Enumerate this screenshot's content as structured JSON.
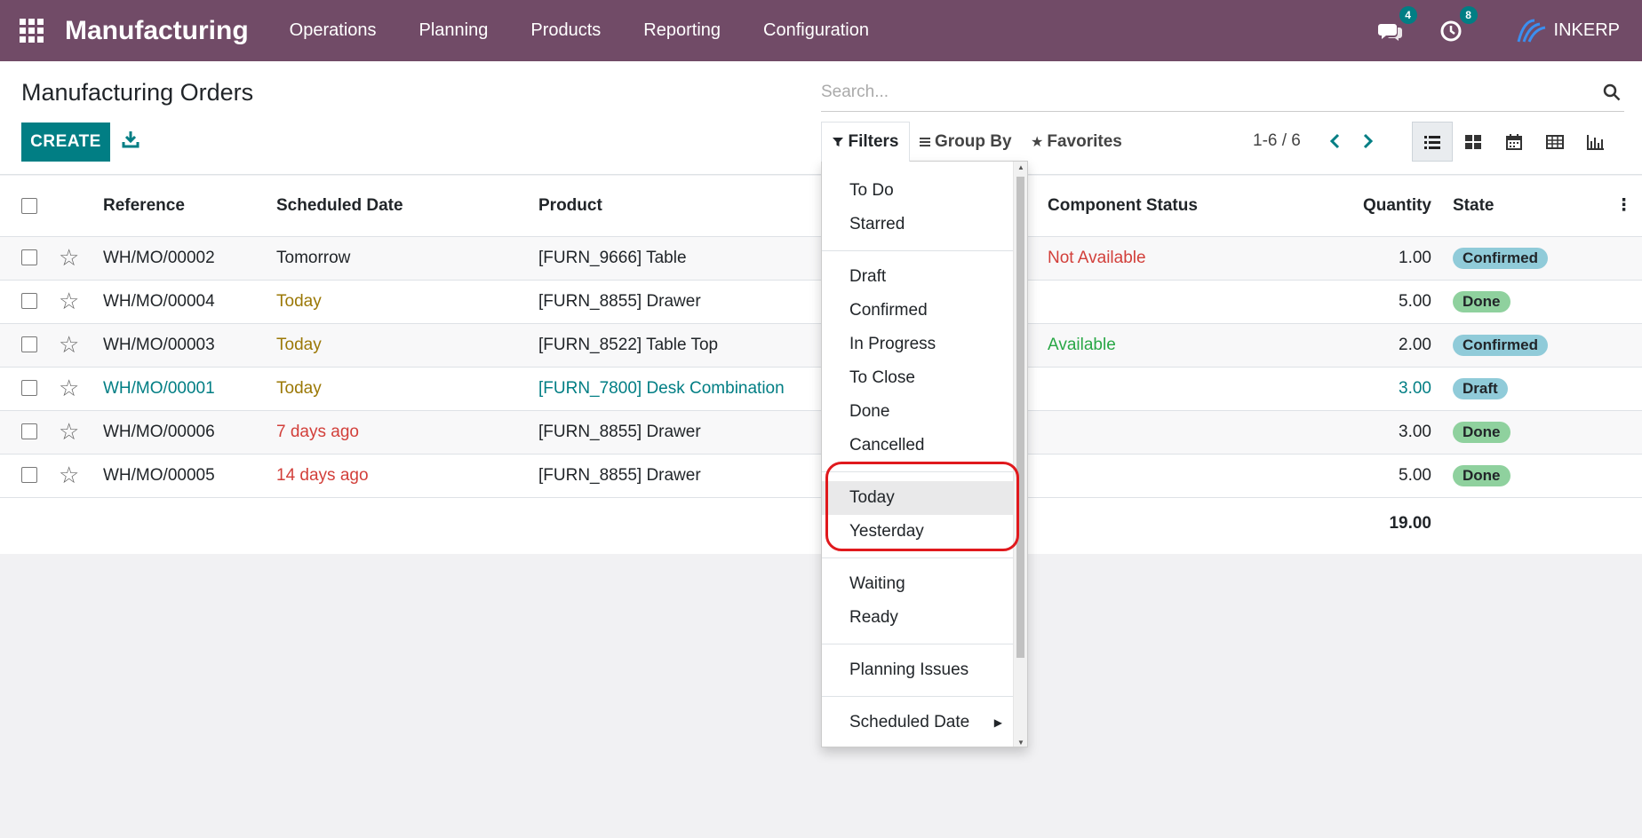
{
  "navbar": {
    "app_name": "Manufacturing",
    "menu": [
      "Operations",
      "Planning",
      "Products",
      "Reporting",
      "Configuration"
    ],
    "messages_count": "4",
    "activities_count": "8",
    "company": "INKERP",
    "bg_color": "#714b67"
  },
  "control": {
    "title": "Manufacturing Orders",
    "create_label": "CREATE",
    "search_placeholder": "Search...",
    "filters_label": "Filters",
    "groupby_label": "Group By",
    "favorites_label": "Favorites",
    "pager": "1-6 / 6"
  },
  "table": {
    "headers": {
      "reference": "Reference",
      "scheduled_date": "Scheduled Date",
      "product": "Product",
      "component_status": "Component Status",
      "quantity": "Quantity",
      "state": "State"
    },
    "rows": [
      {
        "reference": "WH/MO/00002",
        "date": "Tomorrow",
        "product": "[FURN_9666] Table",
        "component_status": "Not Available",
        "quantity": "1.00",
        "state": "Confirmed"
      },
      {
        "reference": "WH/MO/00004",
        "date": "Today",
        "product": "[FURN_8855] Drawer",
        "component_status": "",
        "quantity": "5.00",
        "state": "Done"
      },
      {
        "reference": "WH/MO/00003",
        "date": "Today",
        "product": "[FURN_8522] Table Top",
        "component_status": "Available",
        "quantity": "2.00",
        "state": "Confirmed"
      },
      {
        "reference": "WH/MO/00001",
        "date": "Today",
        "product": "[FURN_7800] Desk Combination",
        "component_status": "",
        "quantity": "3.00",
        "state": "Draft"
      },
      {
        "reference": "WH/MO/00006",
        "date": "7 days ago",
        "product": "[FURN_8855] Drawer",
        "component_status": "",
        "quantity": "3.00",
        "state": "Done"
      },
      {
        "reference": "WH/MO/00005",
        "date": "14 days ago",
        "product": "[FURN_8855] Drawer",
        "component_status": "",
        "quantity": "5.00",
        "state": "Done"
      }
    ],
    "total_quantity": "19.00"
  },
  "filters_dropdown": {
    "group1": [
      "To Do",
      "Starred"
    ],
    "group2": [
      "Draft",
      "Confirmed",
      "In Progress",
      "To Close",
      "Done",
      "Cancelled"
    ],
    "group3": [
      "Today",
      "Yesterday"
    ],
    "group4": [
      "Waiting",
      "Ready"
    ],
    "group5": [
      "Planning Issues"
    ],
    "group6": [
      "Scheduled Date"
    ]
  },
  "colors": {
    "primary": "#017e84",
    "warning": "#9b7806",
    "danger": "#d23f3a",
    "success": "#28a745",
    "highlight": "#e0191d"
  }
}
